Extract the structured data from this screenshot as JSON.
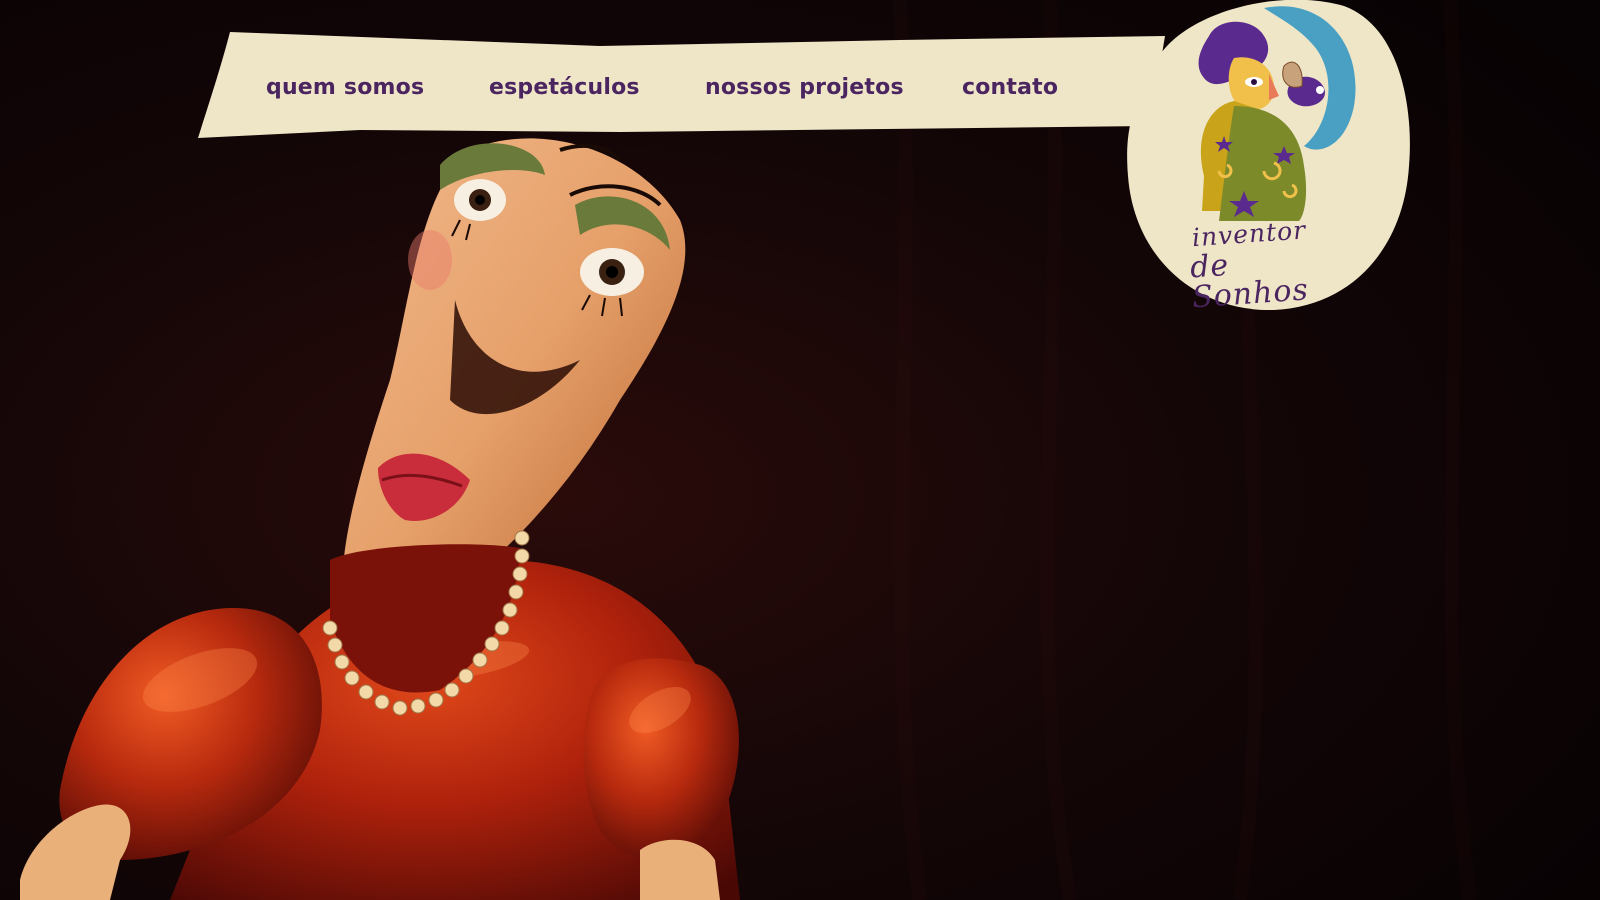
{
  "nav": {
    "items": [
      {
        "label": "quem somos"
      },
      {
        "label": "espetáculos"
      },
      {
        "label": "nossos projetos"
      },
      {
        "label": "contato"
      }
    ]
  },
  "logo": {
    "line1": "inventor",
    "line2": "de Sonhos",
    "icon": "puppet-with-moon-and-bird-icon"
  },
  "hero": {
    "image": "puppet-photo"
  },
  "colors": {
    "banner": "#efe6c8",
    "nav_text": "#4a2560",
    "background": "#0b0405",
    "logo_moon": "#4aa0c3",
    "logo_hair": "#5a2a8e",
    "logo_cloak": "#c9a41a",
    "logo_dress": "#7d8a2a"
  }
}
